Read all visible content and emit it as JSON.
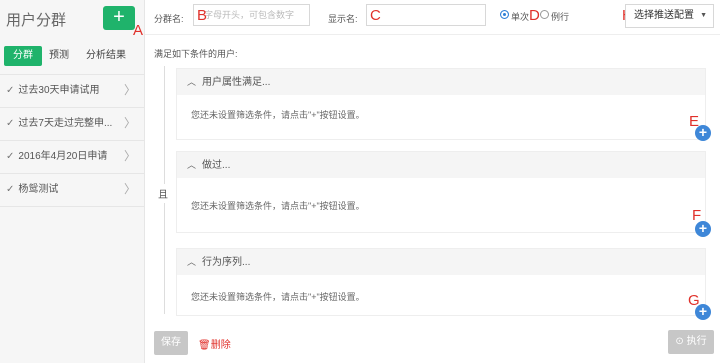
{
  "sidebar": {
    "title": "用户分群",
    "add_label": "+",
    "tabs": [
      "分群",
      "预测",
      "分析结果"
    ],
    "items": [
      {
        "label": "过去30天申请试用"
      },
      {
        "label": "过去7天走过完整申..."
      },
      {
        "label": "2016年4月20日申请"
      },
      {
        "label": "杨鸳测试"
      }
    ]
  },
  "topbar": {
    "group_name_label": "分群名:",
    "group_name_placeholder": "字母开头，可包含数字",
    "display_name_label": "显示名:",
    "display_name_value": "",
    "radio_single": "单次",
    "radio_routine": "例行",
    "push_select": "选择推送配置"
  },
  "main": {
    "condition_title": "满足如下条件的用户:",
    "and_label": "且",
    "boxes": [
      {
        "title": "用户属性满足...",
        "empty_text": "您还未设置筛选条件，请点击\"+\"按钮设置。"
      },
      {
        "title": "做过...",
        "empty_text": "您还未设置筛选条件，请点击\"+\"按钮设置。"
      },
      {
        "title": "行为序列...",
        "empty_text": "您还未设置筛选条件，请点击\"+\"按钮设置。"
      }
    ],
    "plus_label": "+"
  },
  "footer": {
    "save": "保存",
    "delete": "删除",
    "run": "执行"
  },
  "annotations": {
    "A": "A",
    "B": "B",
    "C": "C",
    "D": "D",
    "E": "E",
    "F": "F",
    "G": "G",
    "H": "H"
  },
  "colors": {
    "accent": "#1fb36b",
    "blue": "#3e87d8",
    "annotation": "#e0302a"
  }
}
